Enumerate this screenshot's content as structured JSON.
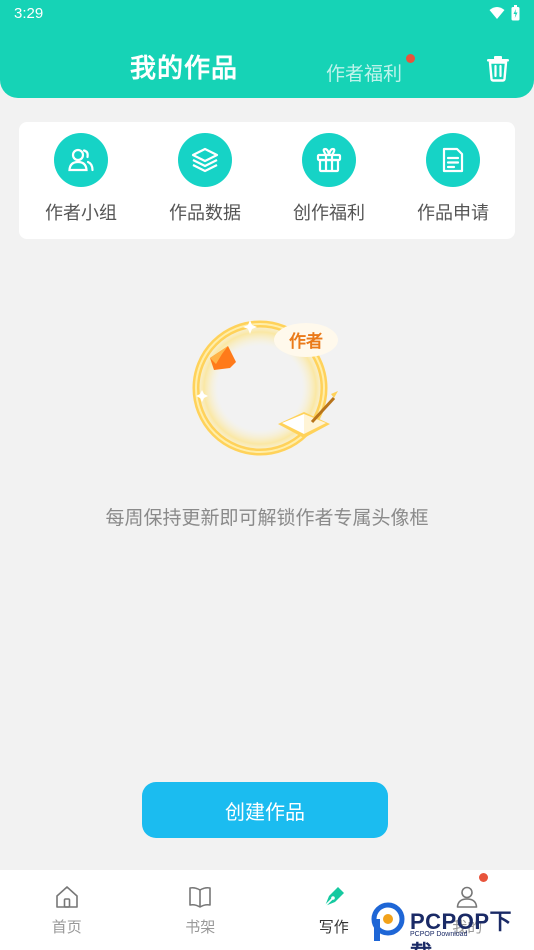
{
  "status": {
    "time": "3:29"
  },
  "header": {
    "title": "我的作品",
    "tab": "作者福利"
  },
  "quick_actions": [
    {
      "label": "作者小组",
      "icon": "users-icon"
    },
    {
      "label": "作品数据",
      "icon": "layers-icon"
    },
    {
      "label": "创作福利",
      "icon": "gift-icon"
    },
    {
      "label": "作品申请",
      "icon": "document-icon"
    }
  ],
  "illustration": {
    "badge_text": "作者"
  },
  "empty_message": "每周保持更新即可解锁作者专属头像框",
  "create_button": "创建作品",
  "bottom_nav": [
    {
      "label": "首页",
      "icon": "home-icon"
    },
    {
      "label": "书架",
      "icon": "book-icon"
    },
    {
      "label": "写作",
      "icon": "pen-icon",
      "active": true
    },
    {
      "label": "我的",
      "icon": "user-icon"
    }
  ],
  "watermark": {
    "main": "PCPOP下载",
    "sub": "PCPOP Download"
  },
  "colors": {
    "brand": "#16d3b6",
    "icon_bg": "#16d3c6",
    "button": "#1bbcf0",
    "badge": "#e8543c"
  }
}
